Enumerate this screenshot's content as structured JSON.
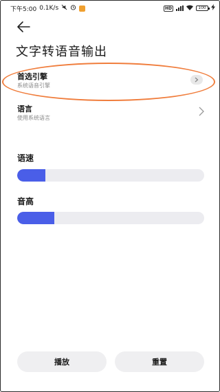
{
  "status_bar": {
    "time": "下午5:00",
    "speed": "0.1K/s",
    "battery": "100"
  },
  "header": {
    "title": "文字转语音输出"
  },
  "settings": [
    {
      "title": "首选引擎",
      "subtitle": "系统语音引擎"
    },
    {
      "title": "语言",
      "subtitle": "使用系统语言"
    }
  ],
  "sliders": [
    {
      "label": "语速",
      "level_percent": 15
    },
    {
      "label": "音高",
      "level_percent": 20
    }
  ],
  "buttons": {
    "play": "播放",
    "reset": "重置"
  },
  "colors": {
    "accent": "#4a5ee8",
    "highlight": "#f07d3c",
    "track": "#ececf0"
  }
}
